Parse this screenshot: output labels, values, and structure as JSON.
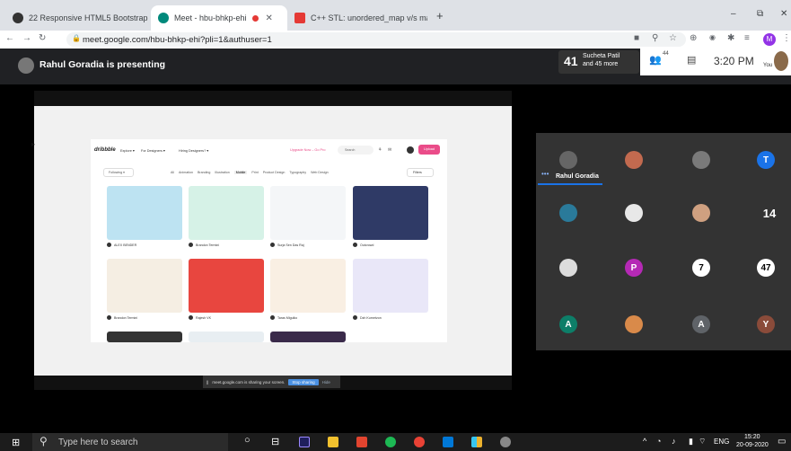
{
  "browser": {
    "tabs": [
      {
        "label": "22 Responsive HTML5 Bootstrap",
        "close": "✕"
      },
      {
        "label": "Meet - hbu-bhkp-ehi",
        "close": "✕"
      },
      {
        "label": "C++ STL: unordered_map v/s ma",
        "close": "✕"
      }
    ],
    "new_tab": "+",
    "url": "meet.google.com/hbu-bhkp-ehi?pli=1&authuser=1",
    "profile_initial": "M",
    "window_controls": [
      "–",
      "⧉",
      "✕"
    ]
  },
  "meet": {
    "presenting": "Rahul Goradia is presenting",
    "participants_count": "41",
    "participants_label1": "Sucheta Patil",
    "participants_label2": "and 45 more",
    "people_count": "44",
    "time": "3:20 PM",
    "you_label": "You",
    "grid": {
      "speaker_name": "Rahul Goradia",
      "tiles": [
        {
          "letter": "",
          "color": "#666"
        },
        {
          "letter": "",
          "color": "#c26a4f"
        },
        {
          "letter": "",
          "color": "#7a7a7a"
        },
        {
          "letter": "T",
          "color": "#1a73e8"
        },
        {
          "letter": "",
          "color": "#2a7a9a"
        },
        {
          "letter": "",
          "color": "#e8e8e8"
        },
        {
          "letter": "",
          "color": "#cfa080"
        },
        {
          "letter": "14",
          "color": "transparent"
        },
        {
          "letter": "",
          "color": "#dcdcdc"
        },
        {
          "letter": "P",
          "color": "#b529b5"
        },
        {
          "letter": "7",
          "color": "#fff"
        },
        {
          "letter": "47",
          "color": "#fff"
        },
        {
          "letter": "A",
          "color": "#0d7e68"
        },
        {
          "letter": "",
          "color": "#d98a4a"
        },
        {
          "letter": "A",
          "color": "#5f6368"
        },
        {
          "letter": "Y",
          "color": "#8a4b3a"
        }
      ]
    },
    "sharing": {
      "text": "meet.google.com is sharing your screen.",
      "stop": "Stop sharing",
      "hide": "Hide"
    }
  },
  "dribbble": {
    "logo": "dribbble",
    "nav": [
      "Explore ▾",
      "For Designers ▾",
      "Hiring Designers? ▾"
    ],
    "upgrade": "Upgrade Now – Go Pro",
    "search": "Search",
    "upload": "Upload",
    "following": "Following ▾",
    "filters": [
      "All",
      "Animation",
      "Branding",
      "Illustration",
      "Mobile",
      "Print",
      "Product Design",
      "Typography",
      "Web Design"
    ],
    "filters_btn": "Filters",
    "authors": [
      "ALEX BENDER",
      "Brandon Termini",
      "Surja Sen Das Raj",
      "Outcrowd",
      "Brandon Termini",
      "Rajesh VK",
      "Taras Migulko",
      "Dzh Kurnetzon"
    ]
  },
  "taskbar": {
    "search": "Type here to search",
    "lang": "ENG",
    "clock_time": "15:20",
    "clock_date": "20-09-2020"
  }
}
